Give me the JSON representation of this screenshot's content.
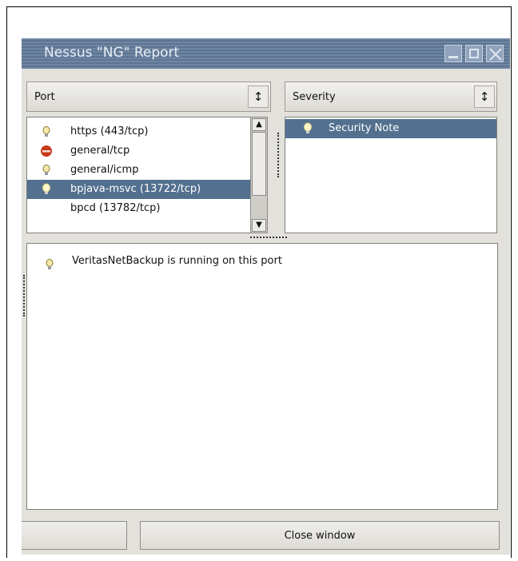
{
  "window": {
    "title": "Nessus \"NG\" Report",
    "controls": [
      "minimize-icon",
      "maximize-icon",
      "close-icon"
    ]
  },
  "port_pane": {
    "header": "Port",
    "items": [
      {
        "label": "https (443/tcp)",
        "icon": "bulb-icon",
        "selected": false
      },
      {
        "label": "general/tcp",
        "icon": "stop-icon",
        "selected": false
      },
      {
        "label": "general/icmp",
        "icon": "bulb-icon",
        "selected": false
      },
      {
        "label": "bpjava-msvc (13722/tcp)",
        "icon": "bulb-icon",
        "selected": true
      },
      {
        "label": "bpcd (13782/tcp)",
        "icon": "",
        "selected": false
      }
    ]
  },
  "severity_pane": {
    "header": "Severity",
    "items": [
      {
        "label": "Security Note",
        "icon": "bulb-icon",
        "selected": true
      }
    ]
  },
  "detail_pane": {
    "message": "VeritasNetBackup is running on this port",
    "icon": "bulb-icon"
  },
  "buttons": {
    "close": "Close window"
  },
  "colors": {
    "selection": "#53708f",
    "titlebar": "#6f86a3",
    "window_bg": "#e3e1dc"
  }
}
